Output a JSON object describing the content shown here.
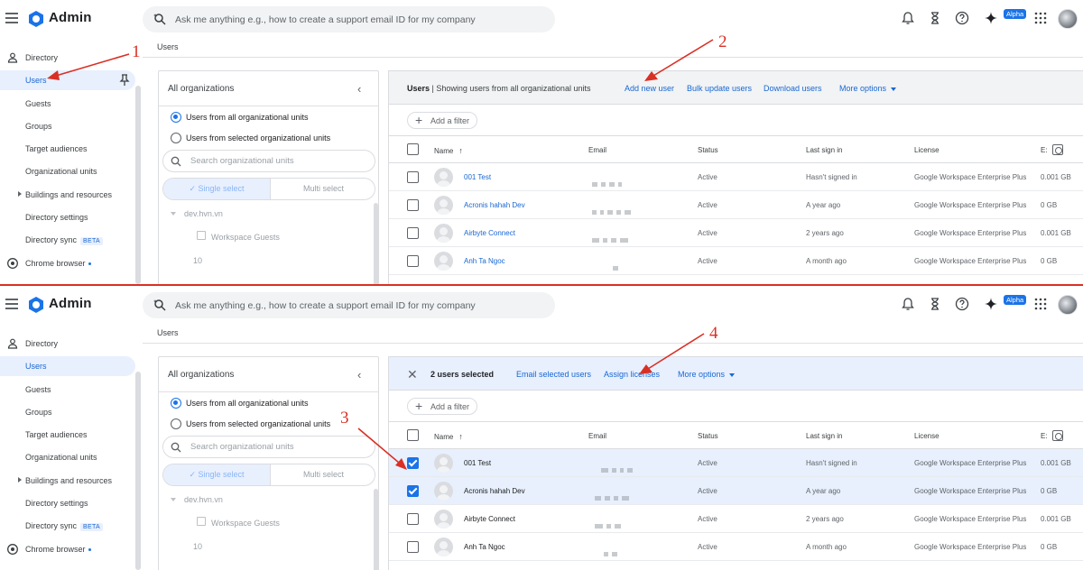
{
  "app": {
    "title": "Admin"
  },
  "search": {
    "placeholder": "Ask me anything e.g., how to create a support email ID for my company"
  },
  "topbar": {
    "badge": "Alpha"
  },
  "icons": [
    "menu-icon",
    "admin-logo-icon",
    "search-spark-icon",
    "bell-icon",
    "hourglass-icon",
    "help-icon",
    "gemini-icon",
    "apps-grid-icon",
    "avatar",
    "pin-icon",
    "person-icon",
    "chrome-icon",
    "close-icon",
    "plus-icon",
    "sort-arrow-icon",
    "column-settings-icon",
    "folder-icon"
  ],
  "colors": {
    "accent": "#1a73e8",
    "link": "#1967d2",
    "active_bg": "#e8f0fe",
    "annotation": "#d93025"
  },
  "sidebar": {
    "items": [
      {
        "label": "Directory"
      },
      {
        "label": "Users"
      },
      {
        "label": "Guests"
      },
      {
        "label": "Groups"
      },
      {
        "label": "Target audiences"
      },
      {
        "label": "Organizational units"
      },
      {
        "label": "Buildings and resources"
      },
      {
        "label": "Directory settings"
      },
      {
        "label": "Directory sync",
        "badge": "BETA"
      },
      {
        "label": "Chrome browser"
      }
    ]
  },
  "breadcrumb": "Users",
  "org_panel": {
    "title": "All organizations",
    "collapse": "‹",
    "radio_all": "Users from all organizational units",
    "radio_selected": "Users from selected organizational units",
    "search_placeholder": "Search organizational units",
    "single_select": "✓ Single select",
    "multi_select": "Multi select",
    "tree_root": "dev.hvn.vn",
    "tree_child": "Workspace Guests",
    "tree_more": "10"
  },
  "toolbar1": {
    "title_bold": "Users",
    "title_rest": " | Showing users from all organizational units",
    "add_user": "Add new user",
    "bulk_update": "Bulk update users",
    "download": "Download users",
    "more": "More options"
  },
  "toolbar2": {
    "close": "✕",
    "selected_count": "2 users selected",
    "email_selected": "Email selected users",
    "assign_licenses": "Assign licenses",
    "more": "More options"
  },
  "filter": {
    "label": "Add a filter",
    "plus": "+"
  },
  "table": {
    "columns": {
      "name": "Name",
      "sort": "↑",
      "email": "Email",
      "status": "Status",
      "last_sign_in": "Last sign in",
      "license": "License",
      "extra": "E:"
    },
    "rows": [
      {
        "name": "001 Test",
        "status": "Active",
        "last": "Hasn't signed in",
        "license": "Google Workspace Enterprise Plus",
        "storage": "0.001 GB"
      },
      {
        "name": "Acronis hahah Dev",
        "status": "Active",
        "last": "A year ago",
        "license": "Google Workspace Enterprise Plus",
        "storage": "0 GB"
      },
      {
        "name": "Airbyte Connect",
        "status": "Active",
        "last": "2 years ago",
        "license": "Google Workspace Enterprise Plus",
        "storage": "0.001 GB"
      },
      {
        "name": "Anh Ta Ngoc",
        "status": "Active",
        "last": "A month ago",
        "license": "Google Workspace Enterprise Plus",
        "storage": "0 GB"
      }
    ],
    "selected_rows_panel2": [
      true,
      true,
      false,
      false
    ]
  },
  "annotations": {
    "one": "1",
    "two": "2",
    "three": "3",
    "four": "4"
  }
}
